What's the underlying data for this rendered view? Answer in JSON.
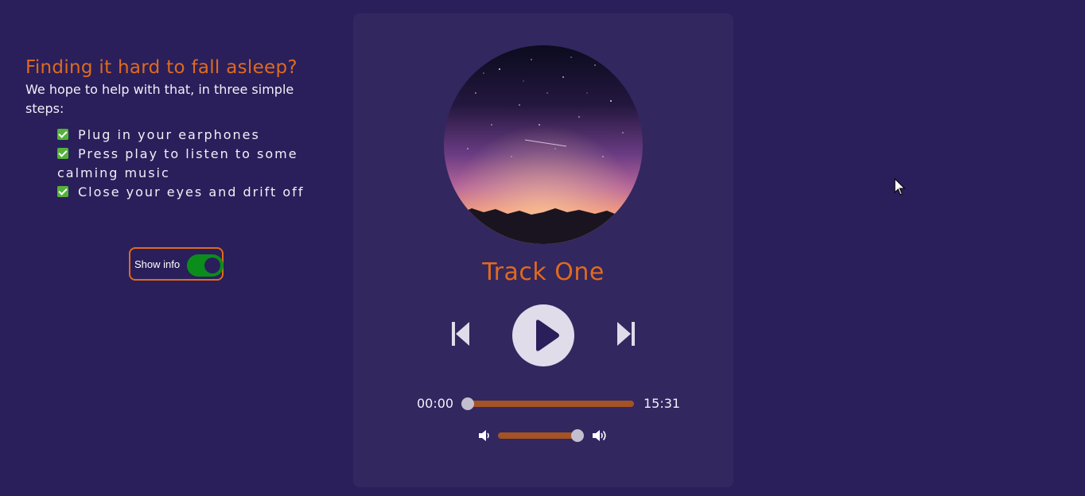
{
  "info": {
    "title": "Finding it hard to fall asleep?",
    "intro": "We hope to help with that, in three simple steps:",
    "steps": [
      "Plug in your earphones",
      "Press play to listen to some calming music",
      "Close your eyes and drift off"
    ]
  },
  "toggle": {
    "label": "Show info",
    "on": true
  },
  "player": {
    "track_title": "Track One",
    "current_time": "00:00",
    "total_time": "15:31",
    "progress": 0.0,
    "volume": 1.0
  },
  "colors": {
    "background": "#2a1f5a",
    "card": "#32275f",
    "accent": "#e06a1e",
    "slider": "#a45325",
    "toggle_on": "#0b8d1c"
  },
  "icons": {
    "check": "check-mark-icon",
    "previous": "skip-previous-icon",
    "play": "play-icon",
    "next": "skip-next-icon",
    "volume_low": "volume-low-icon",
    "volume_high": "volume-high-icon"
  }
}
